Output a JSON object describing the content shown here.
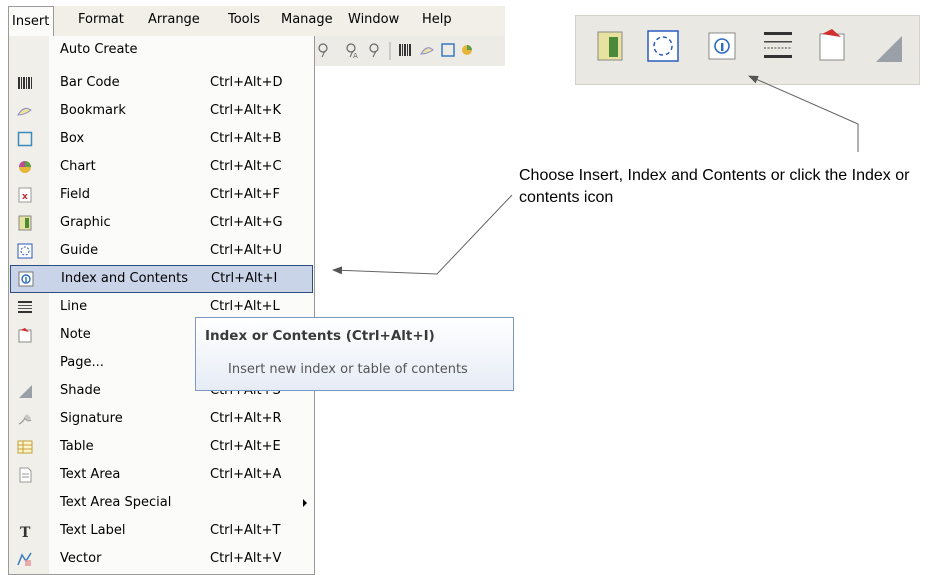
{
  "menubar": {
    "items": [
      "Insert",
      "Format",
      "Arrange",
      "Tools",
      "Manage",
      "Window",
      "Help"
    ]
  },
  "menu": {
    "items": [
      {
        "label": "Auto Create",
        "shortcut": "",
        "icon": "none"
      },
      {
        "label": "Bar Code",
        "shortcut": "Ctrl+Alt+D",
        "icon": "barcode-icon"
      },
      {
        "label": "Bookmark",
        "shortcut": "Ctrl+Alt+K",
        "icon": "bookmark-icon"
      },
      {
        "label": "Box",
        "shortcut": "Ctrl+Alt+B",
        "icon": "box-icon"
      },
      {
        "label": "Chart",
        "shortcut": "Ctrl+Alt+C",
        "icon": "chart-icon"
      },
      {
        "label": "Field",
        "shortcut": "Ctrl+Alt+F",
        "icon": "field-icon"
      },
      {
        "label": "Graphic",
        "shortcut": "Ctrl+Alt+G",
        "icon": "graphic-icon"
      },
      {
        "label": "Guide",
        "shortcut": "Ctrl+Alt+U",
        "icon": "guide-icon"
      },
      {
        "label": "Index and Contents",
        "shortcut": "Ctrl+Alt+I",
        "icon": "index-icon"
      },
      {
        "label": "Line",
        "shortcut": "Ctrl+Alt+L",
        "icon": "line-icon"
      },
      {
        "label": "Note",
        "shortcut": "",
        "icon": "note-icon"
      },
      {
        "label": "Page...",
        "shortcut": "",
        "icon": "none"
      },
      {
        "label": "Shade",
        "shortcut": "Ctrl+Alt+S",
        "icon": "shade-icon"
      },
      {
        "label": "Signature",
        "shortcut": "Ctrl+Alt+R",
        "icon": "signature-icon"
      },
      {
        "label": "Table",
        "shortcut": "Ctrl+Alt+E",
        "icon": "table-icon"
      },
      {
        "label": "Text Area",
        "shortcut": "Ctrl+Alt+A",
        "icon": "textarea-icon"
      },
      {
        "label": "Text Area Special",
        "shortcut": "",
        "icon": "none"
      },
      {
        "label": "Text Label",
        "shortcut": "Ctrl+Alt+T",
        "icon": "textlabel-icon"
      },
      {
        "label": "Vector",
        "shortcut": "Ctrl+Alt+V",
        "icon": "vector-icon"
      }
    ]
  },
  "tooltip": {
    "title": "Index or Contents (Ctrl+Alt+I)",
    "description": "Insert new index or table of contents"
  },
  "caption": "Choose Insert, Index and Contents or click the Index or contents icon",
  "colors": {
    "highlight": "#c9d4e8",
    "highlight_border": "#2c4d7d"
  }
}
